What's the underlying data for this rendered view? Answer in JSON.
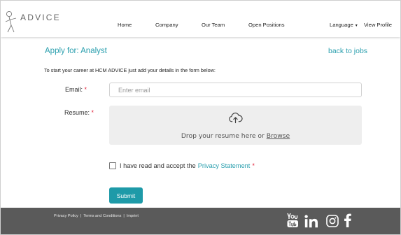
{
  "brand": {
    "logo_text": "ADVICE"
  },
  "nav": {
    "home": "Home",
    "company": "Company",
    "team": "Our Team",
    "positions": "Open Positions",
    "language": "Language",
    "language_caret": "▾",
    "view_profile": "View Profile"
  },
  "page": {
    "title": "Apply for: Analyst",
    "back_link": "back to jobs",
    "intro": "To start your career at HCM ADVICE just add your details in the form below:"
  },
  "form": {
    "email_label": "Email:",
    "email_required": "*",
    "email_placeholder": "Enter email",
    "resume_label": "Resume:",
    "resume_required": "*",
    "drop_text": "Drop your resume here or ",
    "browse_text": "Browse",
    "privacy_text": "I have read and accept the",
    "privacy_link": "Privacy Statement",
    "privacy_required": "*",
    "submit_label": "Submit"
  },
  "footer": {
    "privacy_policy": "Privacy Policy",
    "terms": "Terms and Conditions",
    "imprint": "Imprint",
    "separator": "|"
  },
  "icons": {
    "logo": "stick-figure-logo-icon",
    "upload": "cloud-upload-icon",
    "youtube": "youtube-icon",
    "linkedin": "linkedin-icon",
    "instagram": "instagram-icon",
    "facebook": "facebook-icon"
  },
  "colors": {
    "accent": "#2a9fae",
    "button": "#1e9aa8",
    "required": "#e2233b",
    "footer_bg": "#5a5a5a"
  }
}
